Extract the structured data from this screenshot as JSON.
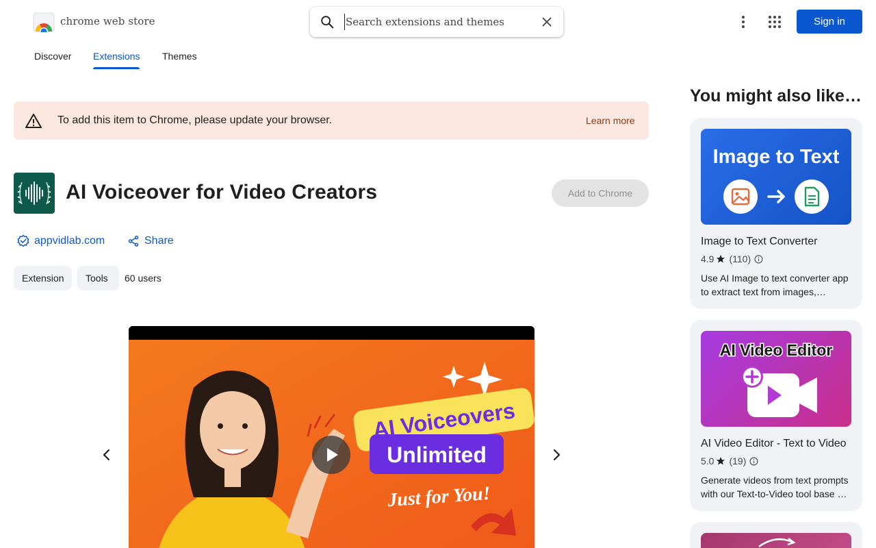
{
  "header": {
    "store_name": "chrome web store",
    "search_placeholder": "Search extensions and themes",
    "search_value": "",
    "sign_in_label": "Sign in"
  },
  "tabs": [
    {
      "label": "Discover",
      "active": false
    },
    {
      "label": "Extensions",
      "active": true
    },
    {
      "label": "Themes",
      "active": false
    }
  ],
  "warning": {
    "text": "To add this item to Chrome, please update your browser.",
    "link": "Learn more"
  },
  "item": {
    "title": "AI Voiceover for Video Creators",
    "add_button": "Add to Chrome",
    "publisher": "appvidlab.com",
    "share": "Share",
    "chips": [
      "Extension",
      "Tools"
    ],
    "users": "60 users"
  },
  "media": {
    "headline_1": "AI Voiceovers",
    "headline_2": "Unlimited",
    "headline_3": "Just for You!"
  },
  "rail": {
    "title": "You might also like…",
    "cards": [
      {
        "thumb_title": "Image to Text",
        "name": "Image to Text Converter",
        "rating": "4.9",
        "count": "(110)",
        "desc": "Use AI Image to text converter app to extract text from images,…"
      },
      {
        "thumb_title": "AI Video Editor",
        "name": "AI Video Editor - Text to Video",
        "rating": "5.0",
        "count": "(19)",
        "desc": "Generate videos from text prompts with our Text-to-Video tool base …"
      }
    ]
  },
  "colors": {
    "accent": "#0b57d0",
    "warning_bg": "#fce8e0",
    "warning_link": "#8e3a12",
    "icon_bg": "#0d5a4a"
  }
}
